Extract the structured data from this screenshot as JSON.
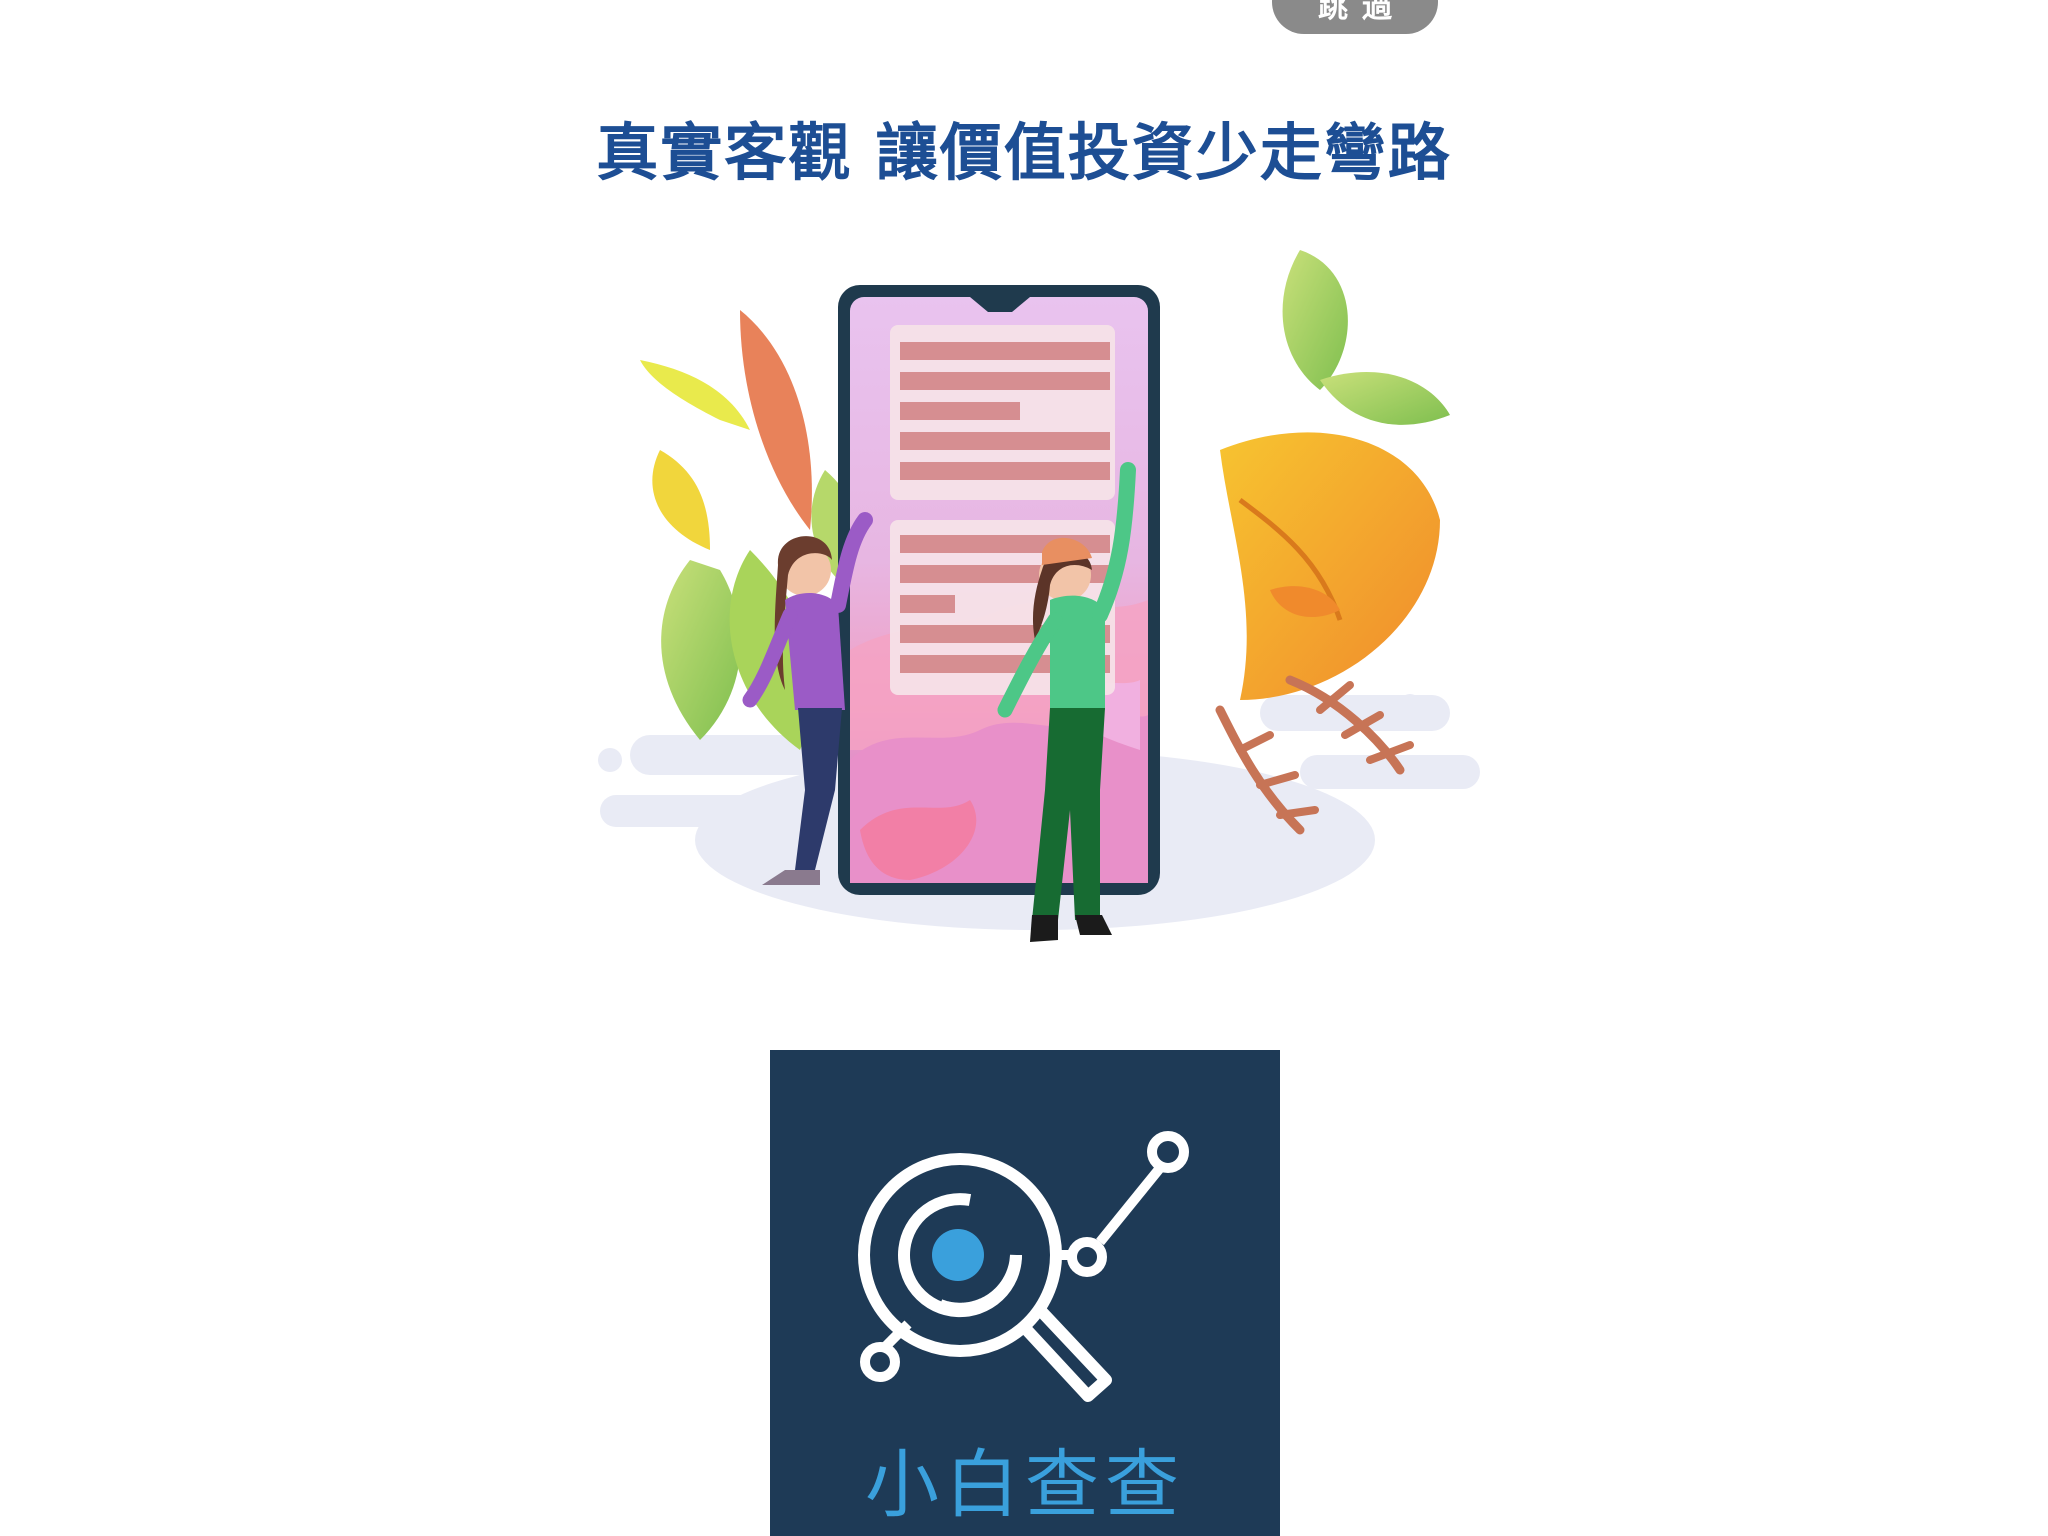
{
  "skip_button": {
    "label": "跳過"
  },
  "headline": {
    "text": "真實客觀 讓價值投資少走彎路"
  },
  "logo": {
    "app_name": "小白查查"
  },
  "colors": {
    "headline": "#1d4e94",
    "logo_background": "#1e3a56",
    "logo_accent": "#3aa0dc",
    "skip_button": "#8a8a8a"
  }
}
